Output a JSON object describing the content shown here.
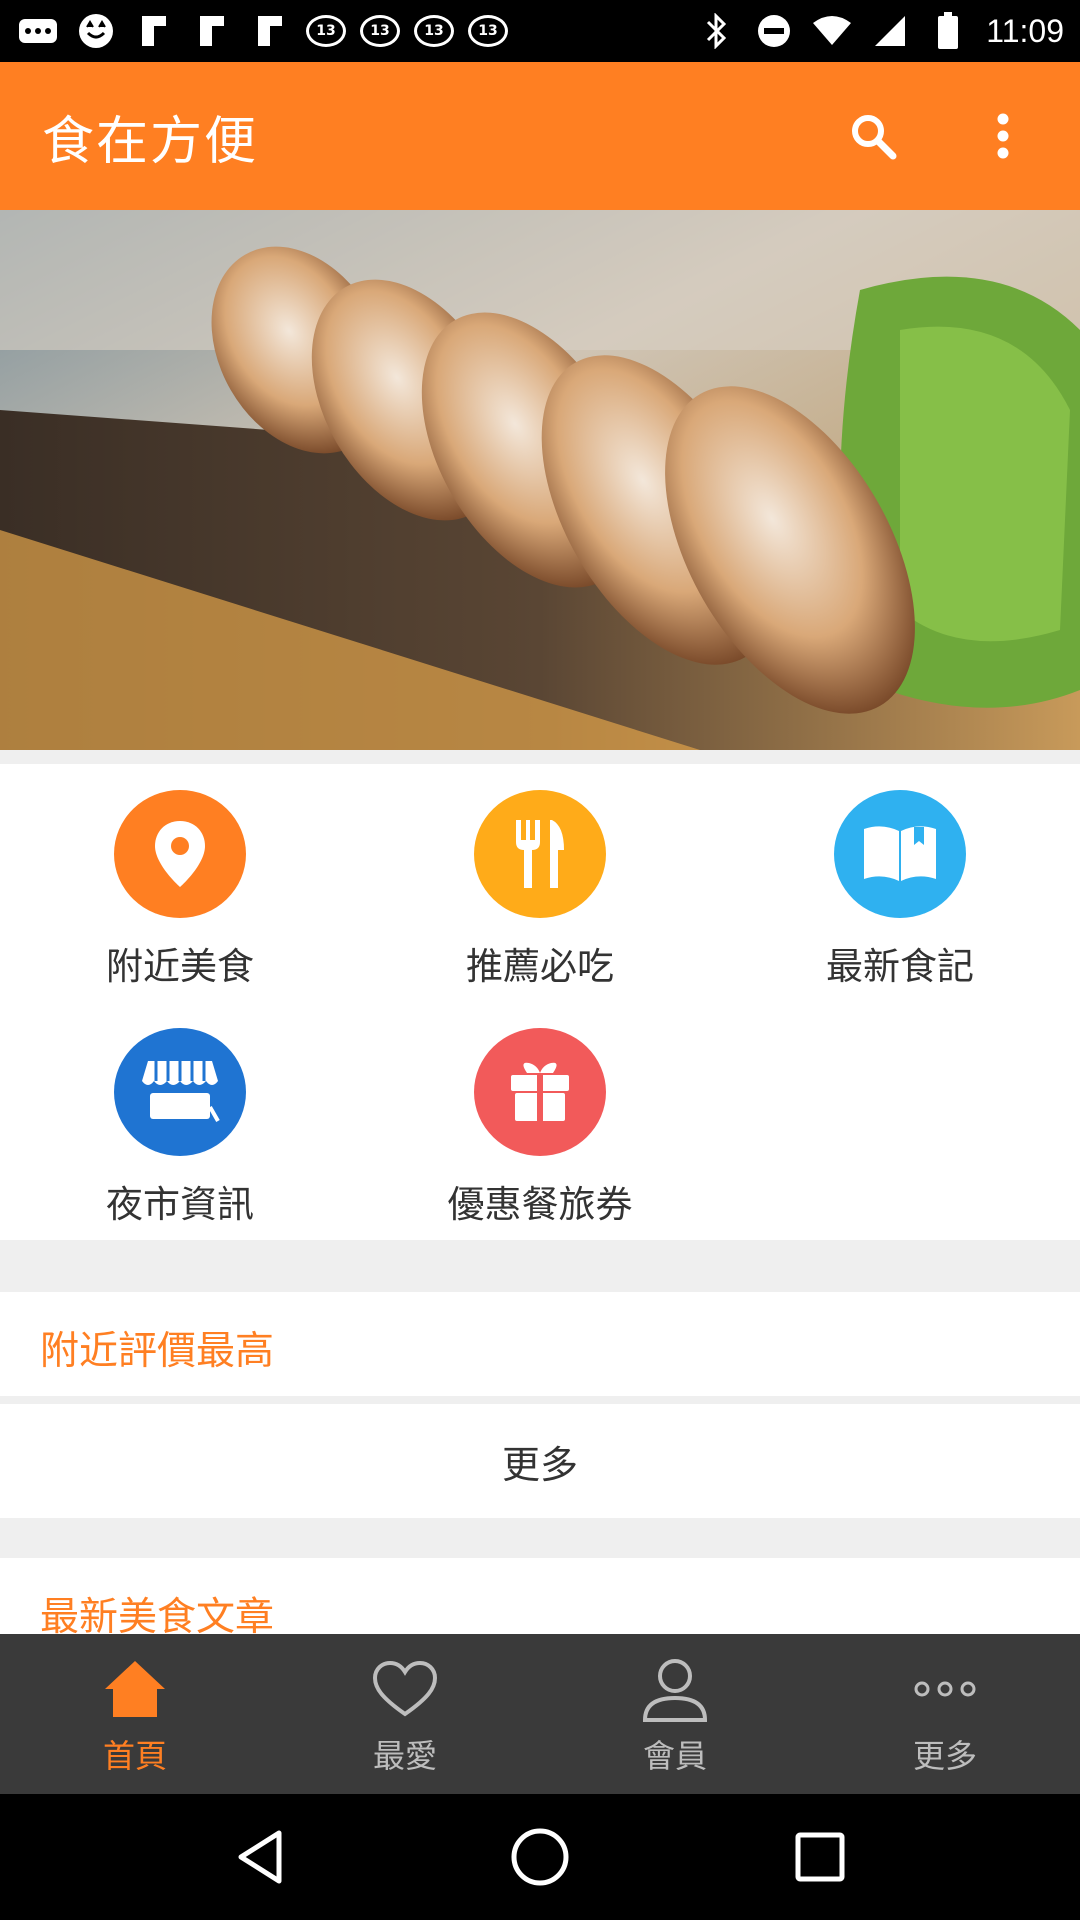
{
  "status_bar": {
    "time": "11:09",
    "notification_icons": [
      "more-horiz-icon",
      "cat-face-icon",
      "flipboard-icon",
      "flipboard-icon",
      "flipboard-icon",
      "abc13-icon",
      "abc13-icon",
      "abc13-icon",
      "abc13-icon"
    ],
    "abc_label": "13",
    "system_icons": [
      "bluetooth-icon",
      "do-not-disturb-icon",
      "wifi-icon",
      "signal-icon",
      "battery-icon"
    ]
  },
  "appbar": {
    "title": "食在方便",
    "search_icon": "search-icon",
    "menu_icon": "more-vert-icon",
    "color": "#ff7f22"
  },
  "hero": {
    "image": "grilled-squid-on-wooden-board"
  },
  "categories": [
    {
      "label": "附近美食",
      "icon": "location-pin-icon",
      "color": "#ff7f22"
    },
    {
      "label": "推薦必吃",
      "icon": "fork-knife-icon",
      "color": "#ffab19"
    },
    {
      "label": "最新食記",
      "icon": "book-icon",
      "color": "#2fb1f0"
    },
    {
      "label": "夜市資訊",
      "icon": "market-stall-icon",
      "color": "#1f74d2"
    },
    {
      "label": "優惠餐旅券",
      "icon": "gift-icon",
      "color": "#f25a5a"
    }
  ],
  "sections": {
    "top_rated_title": "附近評價最高",
    "more_label": "更多",
    "articles_title": "最新美食文章"
  },
  "bottom_nav": [
    {
      "label": "首頁",
      "icon": "home-icon",
      "active": true
    },
    {
      "label": "最愛",
      "icon": "heart-icon",
      "active": false
    },
    {
      "label": "會員",
      "icon": "person-icon",
      "active": false
    },
    {
      "label": "更多",
      "icon": "more-horiz-icon",
      "active": false
    }
  ],
  "system_nav": [
    "back-icon",
    "home-circle-icon",
    "recents-icon"
  ]
}
